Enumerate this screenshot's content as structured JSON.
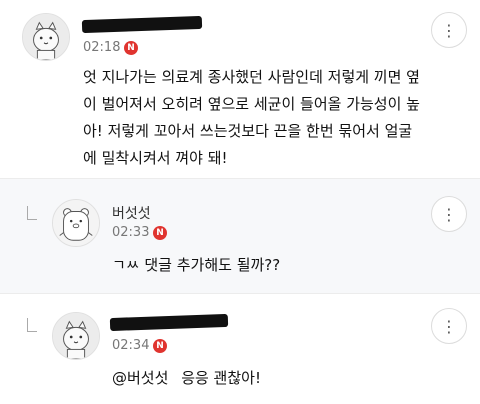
{
  "comments": [
    {
      "time": "02:18",
      "badge": "N",
      "more_label": "⋮",
      "text_lines": [
        "엇 지나가는 의료계 종사했던 사람인데 저렇게 끼면 옆",
        "이 벌어져서 오히려 옆으로 세균이 들어올 가능성이 높",
        "아! 저렇게 꼬아서 쓰는것보다 끈을 한번 묶어서 얼굴",
        "에 밀착시켜서 껴야 돼!"
      ]
    },
    {
      "nickname": "버섯섯",
      "time": "02:33",
      "badge": "N",
      "more_label": "⋮",
      "text": "ㄱㅆ 댓글 추가해도 될까??"
    },
    {
      "time": "02:34",
      "badge": "N",
      "more_label": "⋮",
      "mention": "@버섯섯",
      "text": "응응 괜찮아!"
    }
  ]
}
